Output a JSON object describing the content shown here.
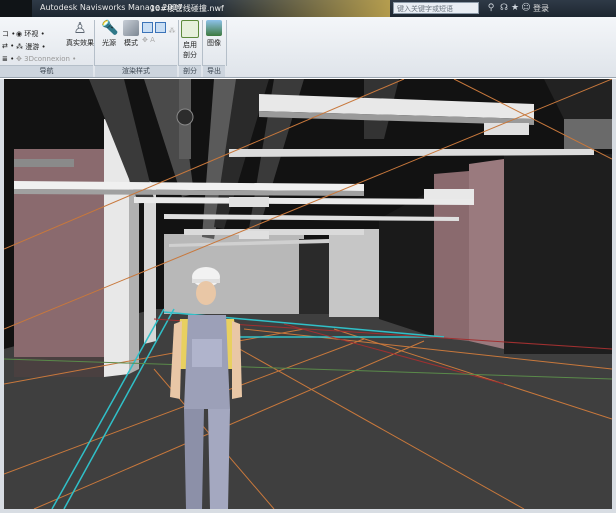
{
  "titlebar": {
    "app_title": "Autodesk Navisworks Manage 2017",
    "file_title": "10#楼管线碰撞.nwf",
    "search_placeholder": "键入关键字或短语",
    "login_label": "登录",
    "icons": [
      "binoculars-icon",
      "user-group-icon",
      "star-icon",
      "user-icon"
    ]
  },
  "ribbon": {
    "nav_items": [
      "环视",
      "漫游",
      "3Dconnexion"
    ],
    "nav_panel_label": "导航",
    "realism_label": "真实效果",
    "light_label": "光源",
    "mode_label": "模式",
    "render_panel_label": "渲染样式",
    "enable_section_label_1": "启用",
    "enable_section_label_2": "剖分",
    "section_panel_label": "剖分",
    "image_label": "图像",
    "export_panel_label": "导出"
  },
  "colors": {
    "viewport_bg": "#161616",
    "floor": "#3f3f3f",
    "wall_pink": "#8a6a6e",
    "duct": "#e8e8e8",
    "grid_orange": "#c8783c",
    "grid_cyan": "#30c0c8",
    "grid_red": "#a03030",
    "worker_shirt": "#e8d060",
    "worker_overalls": "#9ca0b8"
  }
}
